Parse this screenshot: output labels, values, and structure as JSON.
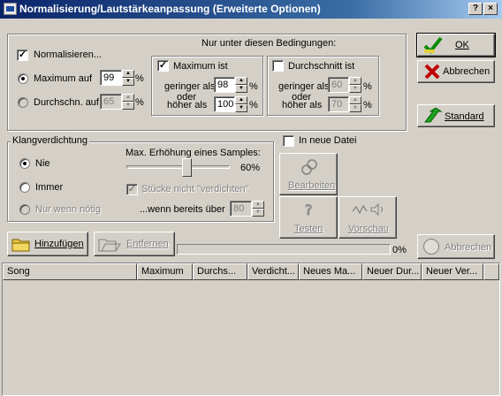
{
  "window": {
    "title": "Normalisierung/Lautstärkeanpassung (Erweiterte Optionen)",
    "help_btn": "?",
    "close_btn": "×"
  },
  "normalize": {
    "checkbox_label": "Normalisieren...",
    "checked": true,
    "max_label": "Maximum auf",
    "max_value": "99",
    "avg_label": "Durchschn. auf",
    "avg_value": "65",
    "percent": "%",
    "selected": "Maximum auf"
  },
  "conditions": {
    "title": "Nur unter diesen Bedingungen:",
    "max": {
      "label": "Maximum ist",
      "checked": true,
      "less_label_1": "geringer als",
      "less_value": "98",
      "or_label": "oder",
      "more_label": "höher als",
      "more_value": "100"
    },
    "avg": {
      "label": "Durchschnitt ist",
      "checked": false,
      "less_label_1": "geringer als",
      "less_value": "60",
      "or_label": "oder",
      "more_label": "höher als",
      "more_value": "70"
    },
    "percent": "%"
  },
  "buttons": {
    "ok": "OK",
    "cancel": "Abbrechen",
    "standard": "Standard"
  },
  "compression": {
    "title": "Klangverdichtung",
    "options": [
      "Nie",
      "Immer",
      "Nur wenn nötig"
    ],
    "selected": "Nie",
    "max_increase_label": "Max. Erhöhung eines Samples:",
    "slider_value": "60%",
    "no_compress_label": "Stücke nicht \"verdichten\"",
    "when_over_label": "...wenn bereits über",
    "when_over_value": "80"
  },
  "new_file": {
    "label": "In neue Datei",
    "checked": false
  },
  "tools": {
    "edit": "Bearbeiten",
    "test": "Testen",
    "preview": "Vorschau"
  },
  "bottom": {
    "add": "Hinzufügen",
    "remove": "Entfernen",
    "progress": "0%",
    "progress_value": 0,
    "cancel": "Abbrechen"
  },
  "table": {
    "columns": [
      "Song",
      "Maximum",
      "Durchs...",
      "Verdicht...",
      "Neues Ma...",
      "Neuer Dur...",
      "Neuer Ver..."
    ]
  }
}
